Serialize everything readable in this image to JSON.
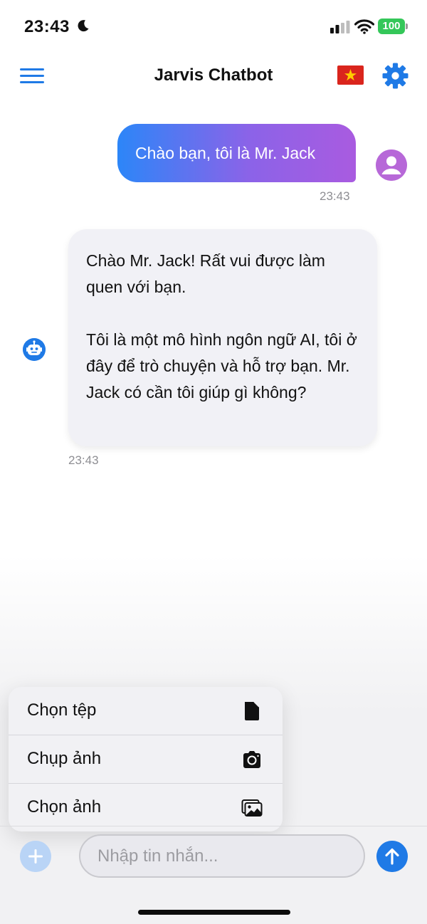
{
  "status_bar": {
    "time": "23:43",
    "battery_level": "100",
    "moon_icon": "moon-icon",
    "signal_icon": "cellular-signal-icon",
    "wifi_icon": "wifi-icon",
    "battery_icon": "battery-icon"
  },
  "header": {
    "title": "Jarvis Chatbot",
    "menu_icon": "hamburger-menu-icon",
    "language_icon": "vietnam-flag-icon",
    "settings_icon": "gear-icon"
  },
  "messages": [
    {
      "sender": "user",
      "text": "Chào bạn, tôi là Mr. Jack",
      "time": "23:43",
      "avatar_icon": "user-avatar-icon"
    },
    {
      "sender": "bot",
      "paragraphs": [
        "Chào Mr. Jack! Rất vui được làm quen với bạn.",
        "Tôi là một mô hình ngôn ngữ AI, tôi ở đây để trò chuyện và hỗ trợ bạn. Mr. Jack có cần tôi giúp gì không?"
      ],
      "time": "23:43",
      "avatar_icon": "robot-icon"
    }
  ],
  "attach_menu": {
    "items": [
      {
        "label": "Chọn tệp",
        "icon": "file-icon"
      },
      {
        "label": "Chụp ảnh",
        "icon": "camera-icon"
      },
      {
        "label": "Chọn ảnh",
        "icon": "photos-icon"
      }
    ]
  },
  "composer": {
    "placeholder": "Nhập tin nhắn...",
    "value": "",
    "add_icon": "plus-icon",
    "send_icon": "arrow-up-icon"
  },
  "colors": {
    "accent": "#1f7ae6",
    "user_bubble_start": "#2c86f8",
    "user_bubble_end": "#a95be0",
    "bot_bubble": "#f1f1f6",
    "battery": "#34c759",
    "user_avatar": "#b768d8"
  }
}
